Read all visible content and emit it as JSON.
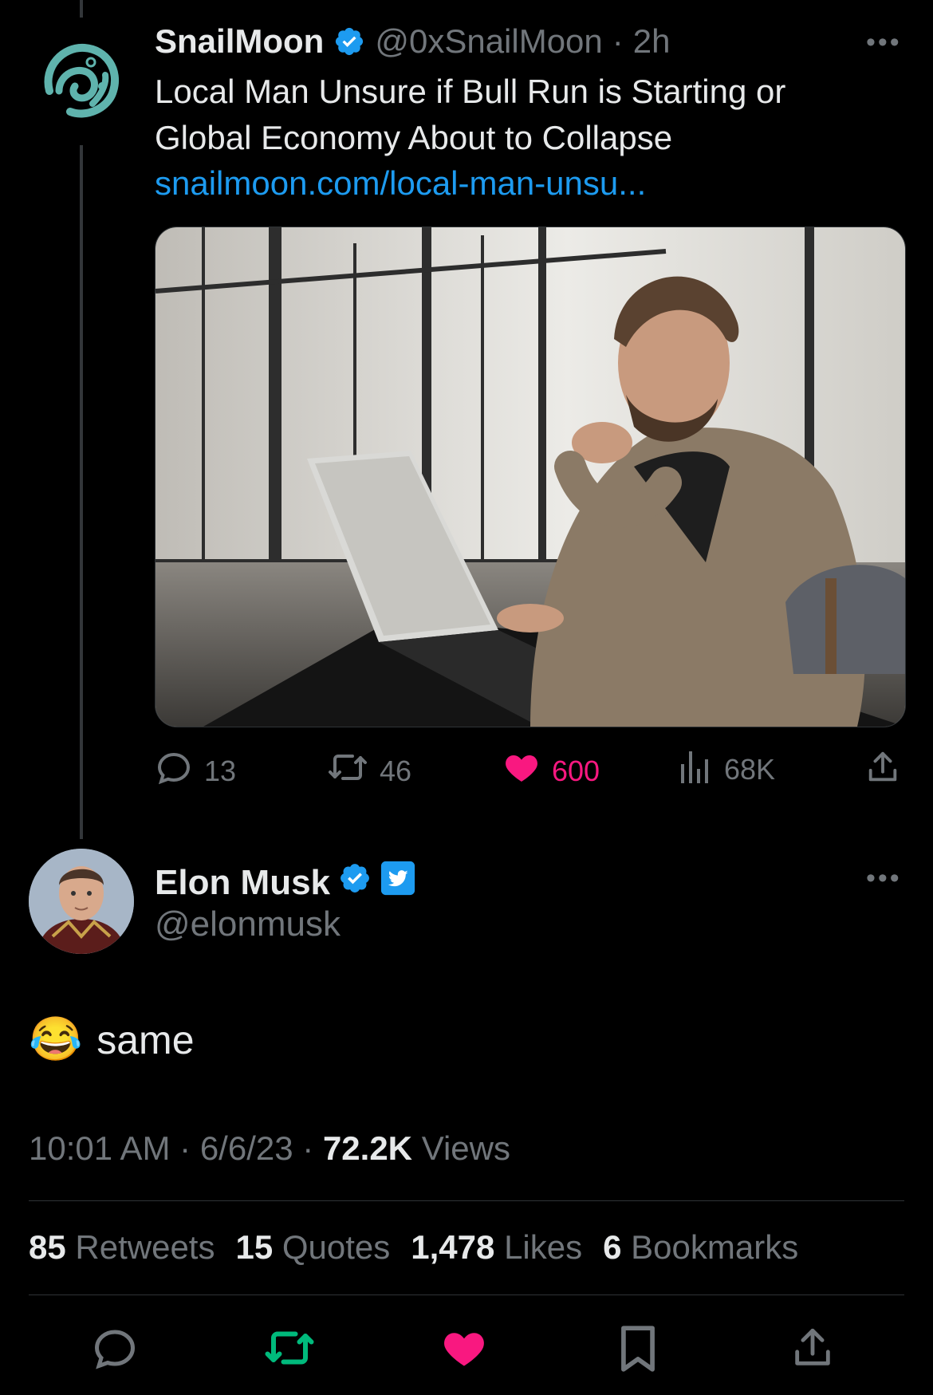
{
  "quoted_tweet": {
    "author_name": "SnailMoon",
    "author_handle": "@0xSnailMoon",
    "time_ago": "2h",
    "text_line1": "Local Man Unsure if Bull Run is Starting or",
    "text_line2": "Global Economy About to Collapse",
    "link": "snailmoon.com/local-man-unsu...",
    "replies": "13",
    "retweets": "46",
    "likes": "600",
    "views": "68K"
  },
  "main_tweet": {
    "author_name": "Elon Musk",
    "author_handle": "@elonmusk",
    "emoji": "😂",
    "text": "same",
    "time": "10:01 AM",
    "date": "6/6/23",
    "views_count": "72.2K",
    "views_label": "Views",
    "stats": [
      {
        "num": "85",
        "label": "Retweets"
      },
      {
        "num": "15",
        "label": "Quotes"
      },
      {
        "num": "1,478",
        "label": "Likes"
      },
      {
        "num": "6",
        "label": "Bookmarks"
      }
    ]
  },
  "colors": {
    "background": "#000000",
    "link": "#1d9bf0",
    "like": "#f91880",
    "retweet_active": "#00ba7c",
    "muted": "#71767b"
  }
}
